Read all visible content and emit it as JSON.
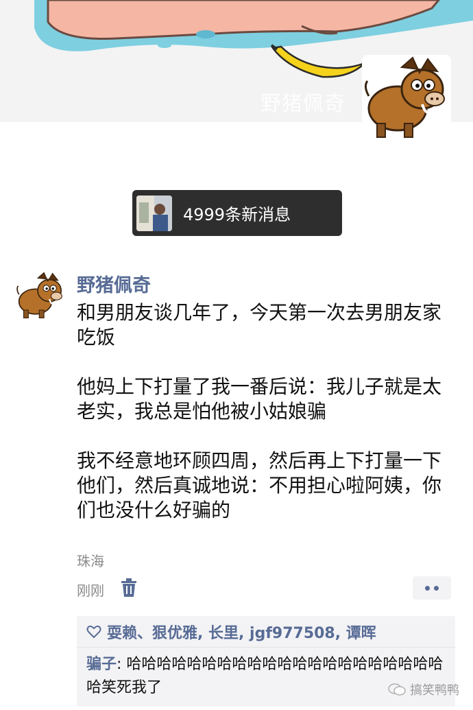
{
  "cover": {
    "watermark": "野猪佩奇"
  },
  "toast": {
    "text": "4999条新消息"
  },
  "moment": {
    "username": "野猪佩奇",
    "paragraphs": [
      "和男朋友谈几年了，今天第一次去男朋友家吃饭",
      "他妈上下打量了我一番后说：我儿子就是太老实，我总是怕他被小姑娘骗",
      "我不经意地环顾四周，然后再上下打量一下他们，然后真诚地说：不用担心啦阿姨，你们也没什么好骗的"
    ],
    "location": "珠海",
    "time": "刚刚"
  },
  "likes": {
    "names": "耍赖、狠优雅, 长里, jgf977508, 谭晖"
  },
  "comment": {
    "author": "骗子",
    "text": "哈哈哈哈哈哈哈哈哈哈哈哈哈哈哈哈哈哈哈哈哈哈笑死我了"
  },
  "footer": {
    "brand": "搞笑鸭鸭"
  },
  "colors": {
    "link": "#576b95",
    "toast_bg": "#2e2e2e",
    "panel_bg": "#f3f3f5"
  }
}
